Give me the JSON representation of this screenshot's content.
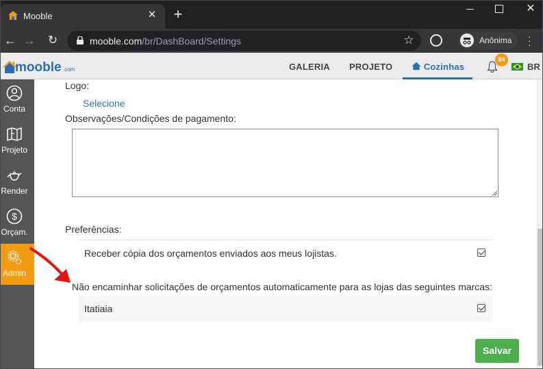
{
  "browser": {
    "tab_title": "Mooble",
    "url_host": "mooble.com",
    "url_path": "/br/DashBoard/Settings",
    "profile_label": "Anônima"
  },
  "header": {
    "logo_text": "mooble",
    "logo_sub": ".com",
    "nav": [
      "GALERIA",
      "PROJETO",
      "Cozinhas"
    ],
    "notif_count": "84",
    "lang": "BR",
    "colors": {
      "brand": "#2b6cb8",
      "badge": "#f39c12"
    }
  },
  "sidebar": {
    "items": [
      {
        "label": "Conta",
        "icon": "user-circle-icon"
      },
      {
        "label": "Projeto",
        "icon": "floorplan-icon"
      },
      {
        "label": "Render",
        "icon": "teapot-icon"
      },
      {
        "label": "Orçam.",
        "icon": "dollar-circle-icon"
      },
      {
        "label": "Admin",
        "icon": "gears-icon"
      }
    ],
    "active_color": "#f39c12"
  },
  "main": {
    "logo_label": "Logo:",
    "logo_select_link": "Selecione",
    "notes_label": "Observações/Condições de pagamento:",
    "notes_value": "",
    "prefs_label": "Preferências:",
    "pref_copy": "Receber cópia dos orçamentos enviados aos meus lojistas.",
    "no_forward_label": "Não encaminhar solicitações de orçamentos automaticamente para as lojas das seguintes marcas:",
    "brand_item": "Itatiaia",
    "save_label": "Salvar",
    "colors": {
      "save": "#4cae4c",
      "link": "#3572b0"
    }
  }
}
